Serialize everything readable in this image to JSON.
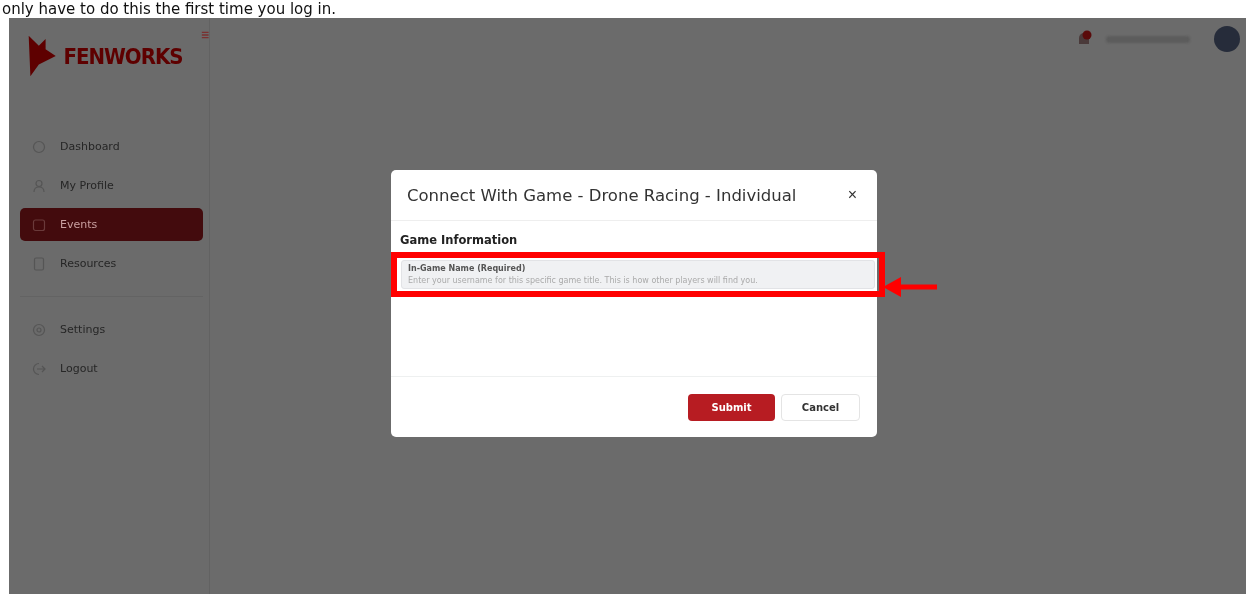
{
  "intro_text": "only have to do this the first time you log in.",
  "app": {
    "logo": "FENWORKS",
    "sidebar": {
      "items": [
        {
          "label": "Dashboard",
          "selected": false
        },
        {
          "label": "My Profile",
          "selected": false
        },
        {
          "label": "Events",
          "selected": true
        },
        {
          "label": "Resources",
          "selected": false
        }
      ],
      "footer_items": [
        {
          "label": "Settings",
          "selected": false
        },
        {
          "label": "Logout",
          "selected": false
        }
      ]
    }
  },
  "modal": {
    "title": "Connect With Game - Drone Racing - Individual",
    "close": "×",
    "section_title": "Game Information",
    "field": {
      "label": "In-Game Name (Required)",
      "placeholder": "Enter your username for this specific game title. This is how other players will find you."
    },
    "buttons": [
      {
        "label": "Submit",
        "kind": "primary"
      },
      {
        "label": "Cancel",
        "kind": "secondary"
      }
    ]
  }
}
